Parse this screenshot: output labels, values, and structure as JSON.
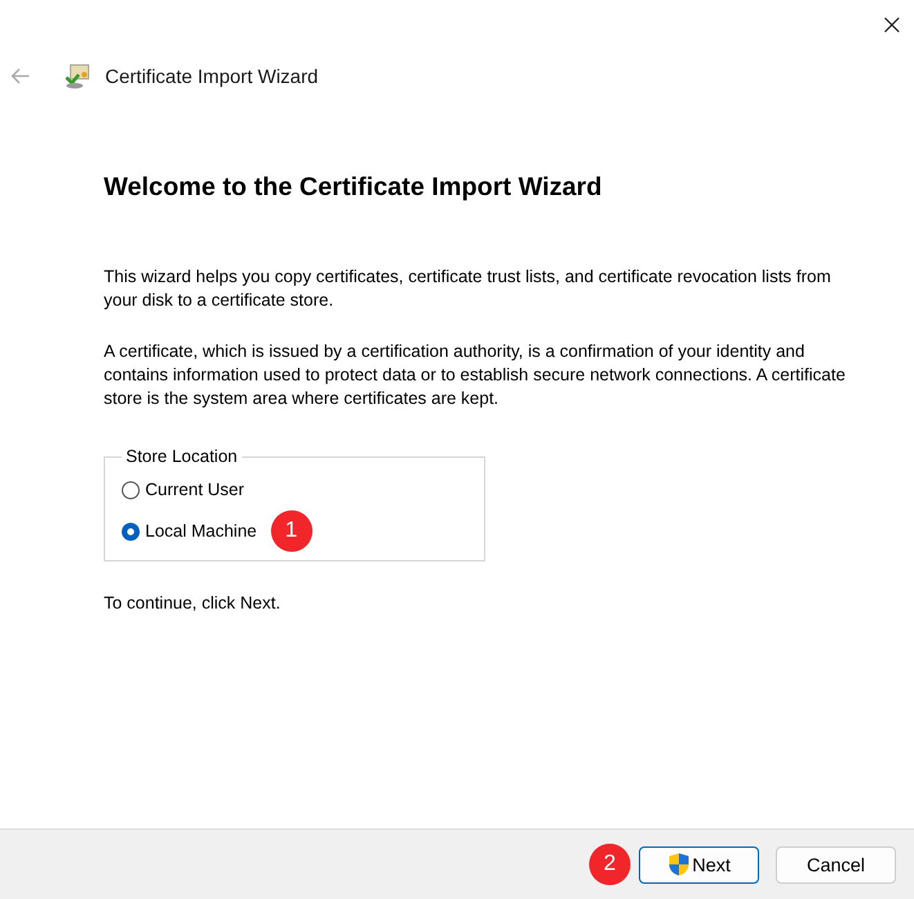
{
  "window": {
    "title": "Certificate Import Wizard"
  },
  "heading": "Welcome to the Certificate Import Wizard",
  "paragraphs": [
    "This wizard helps you copy certificates, certificate trust lists, and certificate revocation lists from your disk to a certificate store.",
    "A certificate, which is issued by a certification authority, is a confirmation of your identity and contains information used to protect data or to establish secure network connections. A certificate store is the system area where certificates are kept."
  ],
  "store_location": {
    "label": "Store Location",
    "options": [
      {
        "label": "Current User",
        "selected": false
      },
      {
        "label": "Local Machine",
        "selected": true,
        "badge": "1"
      }
    ]
  },
  "hint": "To continue, click Next.",
  "buttons": [
    {
      "label": "Next",
      "kind": "primary",
      "badge": "2"
    },
    {
      "label": "Cancel",
      "kind": "secondary"
    }
  ]
}
